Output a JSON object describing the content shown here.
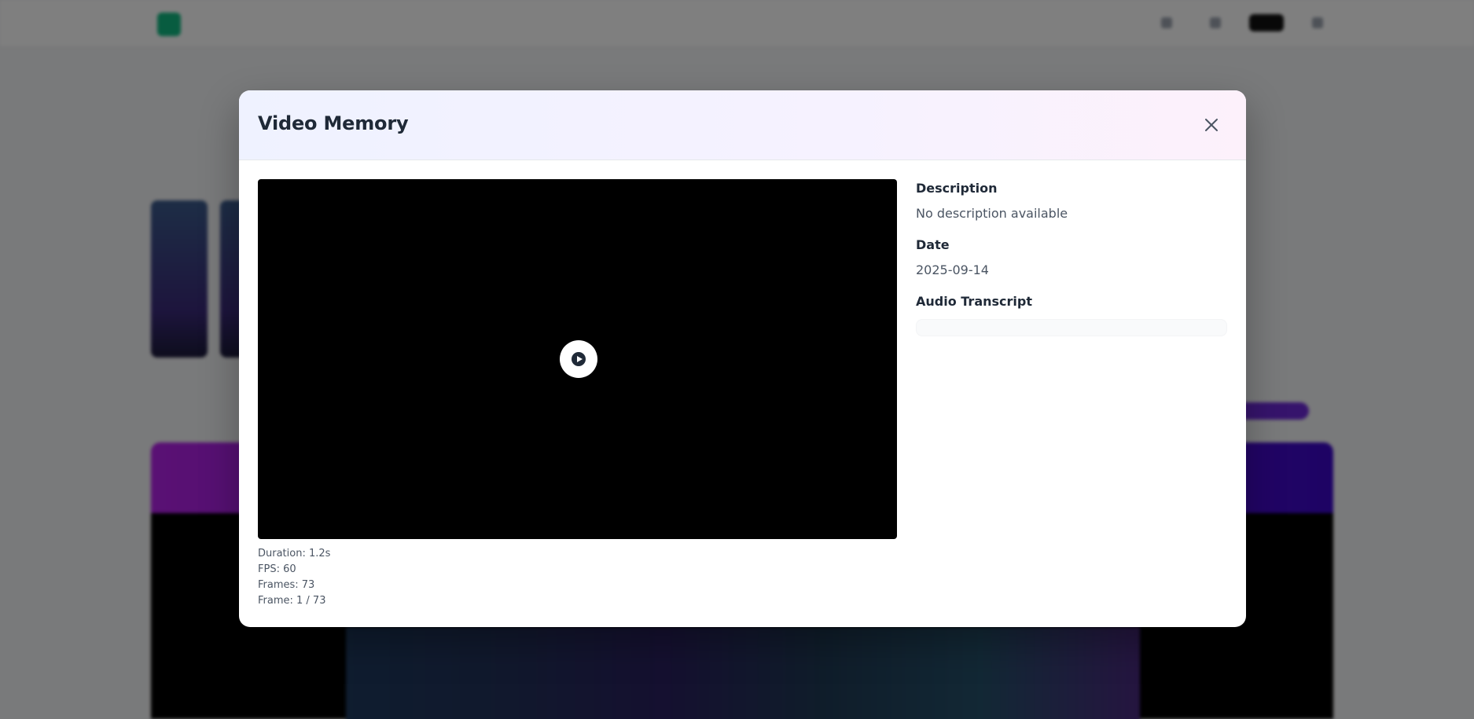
{
  "modal": {
    "title": "Video Memory",
    "close_icon": "close-icon",
    "video": {
      "play_icon": "play-circle-icon",
      "duration": "Duration: 1.2s",
      "fps": "FPS: 60",
      "frames": "Frames: 73",
      "frame_position": "Frame: 1 / 73"
    },
    "details": {
      "description_label": "Description",
      "description_value": "No description available",
      "date_label": "Date",
      "date_value": "2025-09-14",
      "transcript_label": "Audio Transcript",
      "transcript_value": ""
    }
  },
  "colors": {
    "overlay": "rgba(0,0,0,0.5)",
    "header_gradient_start": "#eff2ff",
    "header_gradient_end": "#fdf1fb",
    "banner_gradient_start": "#b422e8",
    "banner_gradient_end": "#3b07c9"
  }
}
